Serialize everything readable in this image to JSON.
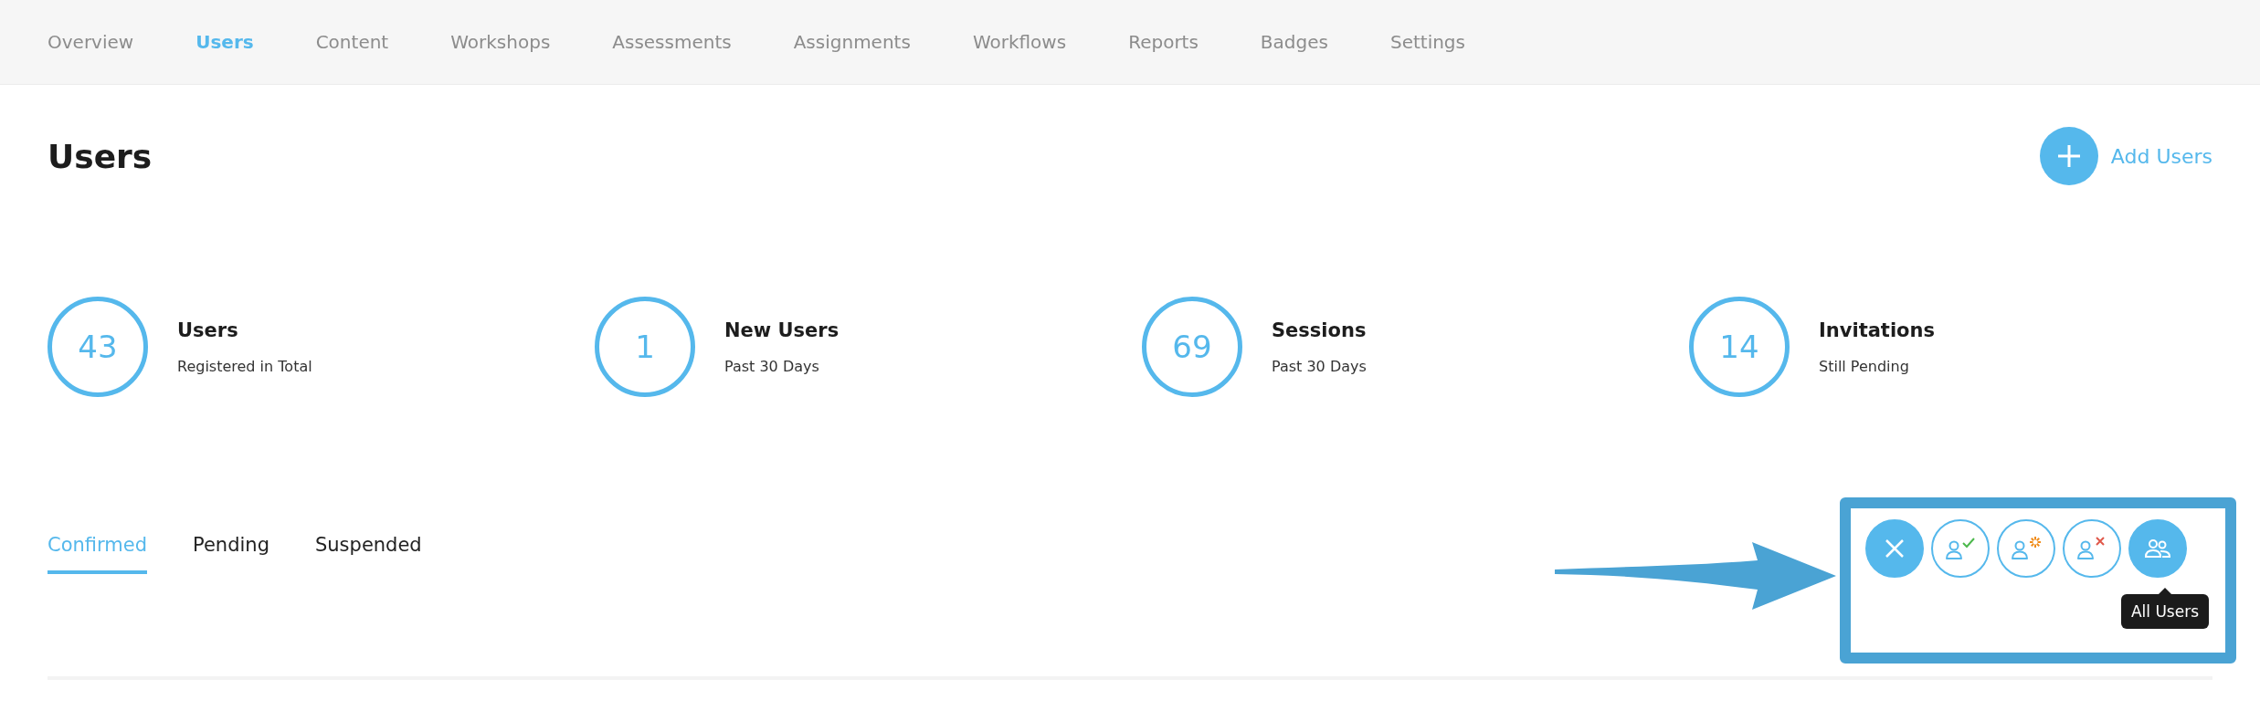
{
  "nav": [
    {
      "label": "Overview",
      "selected": false
    },
    {
      "label": "Users",
      "selected": true
    },
    {
      "label": "Content",
      "selected": false
    },
    {
      "label": "Workshops",
      "selected": false
    },
    {
      "label": "Assessments",
      "selected": false
    },
    {
      "label": "Assignments",
      "selected": false
    },
    {
      "label": "Workflows",
      "selected": false
    },
    {
      "label": "Reports",
      "selected": false
    },
    {
      "label": "Badges",
      "selected": false
    },
    {
      "label": "Settings",
      "selected": false
    }
  ],
  "page_title": "Users",
  "add_button": {
    "label": "Add Users"
  },
  "stats": [
    {
      "value": "43",
      "title": "Users",
      "subtitle": "Registered in Total"
    },
    {
      "value": "1",
      "title": "New Users",
      "subtitle": "Past 30 Days"
    },
    {
      "value": "69",
      "title": "Sessions",
      "subtitle": "Past 30 Days"
    },
    {
      "value": "14",
      "title": "Invitations",
      "subtitle": "Still Pending"
    }
  ],
  "tabs": [
    {
      "label": "Confirmed",
      "selected": true
    },
    {
      "label": "Pending",
      "selected": false
    },
    {
      "label": "Suspended",
      "selected": false
    }
  ],
  "filters": [
    {
      "kind": "close",
      "selected": true
    },
    {
      "kind": "confirmed",
      "selected": false
    },
    {
      "kind": "pending",
      "selected": false
    },
    {
      "kind": "suspended",
      "selected": false
    },
    {
      "kind": "all",
      "selected": true,
      "tooltip": "All Users"
    }
  ]
}
